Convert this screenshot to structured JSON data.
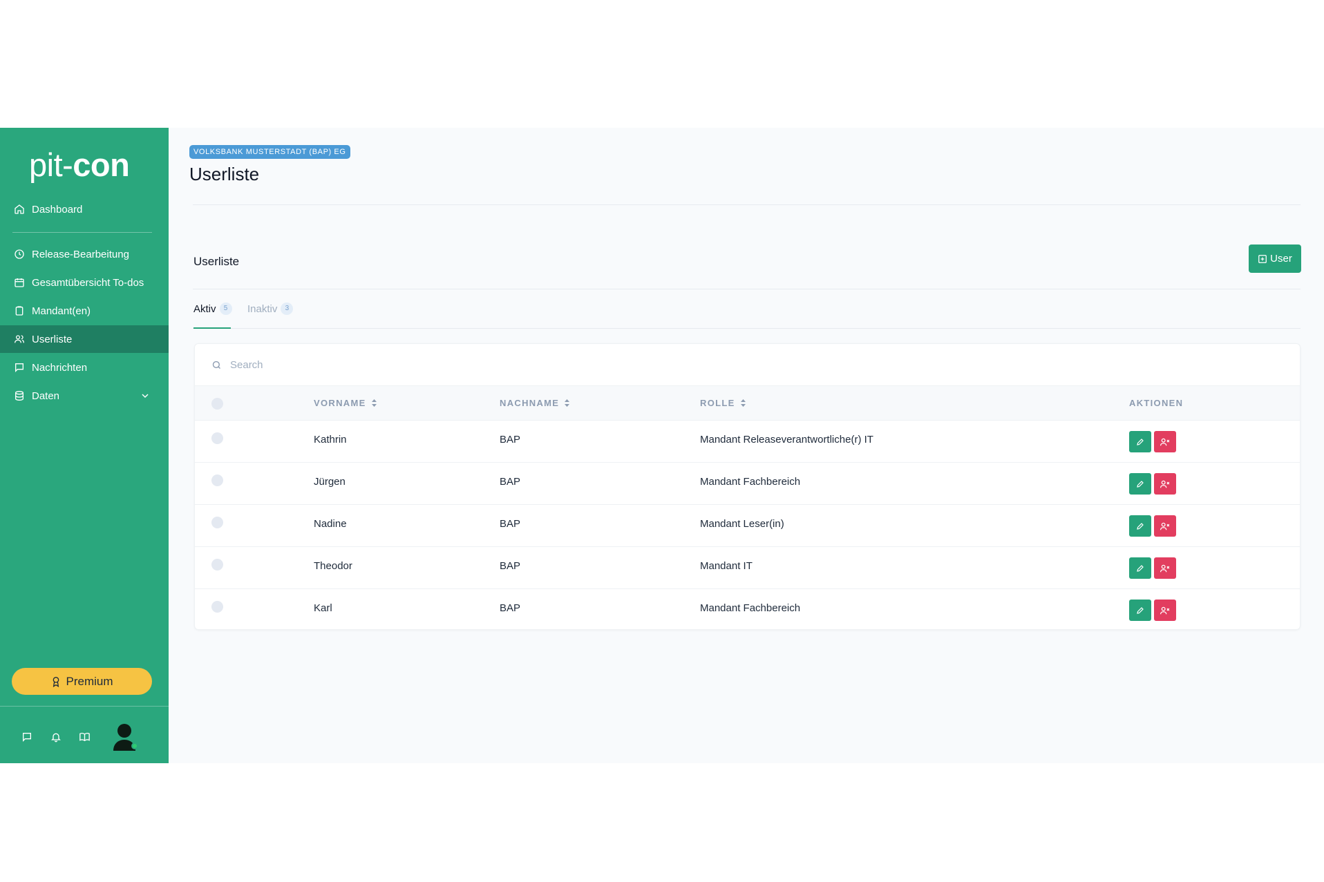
{
  "brand": {
    "logo_light": "pit-",
    "logo_bold": "con"
  },
  "sidebar": {
    "items": [
      {
        "label": "Dashboard"
      },
      {
        "label": "Release-Bearbeitung"
      },
      {
        "label": "Gesamtübersicht To-dos"
      },
      {
        "label": "Mandant(en)"
      },
      {
        "label": "Userliste",
        "active": true
      },
      {
        "label": "Nachrichten"
      },
      {
        "label": "Daten"
      }
    ],
    "premium_label": "Premium"
  },
  "header": {
    "badge": "VOLKSBANK MUSTERSTADT (BAP) EG",
    "title": "Userliste"
  },
  "section": {
    "title": "Userliste",
    "add_button": "User"
  },
  "tabs": [
    {
      "label": "Aktiv",
      "count": "5",
      "active": true
    },
    {
      "label": "Inaktiv",
      "count": "3",
      "active": false
    }
  ],
  "search": {
    "placeholder": "Search"
  },
  "table": {
    "columns": [
      "VORNAME",
      "NACHNAME",
      "ROLLE",
      "AKTIONEN"
    ],
    "rows": [
      {
        "vorname": "Kathrin",
        "nachname": "BAP",
        "rolle": "Mandant Releaseverantwortliche(r) IT"
      },
      {
        "vorname": "Jürgen",
        "nachname": "BAP",
        "rolle": "Mandant Fachbereich"
      },
      {
        "vorname": "Nadine",
        "nachname": "BAP",
        "rolle": "Mandant Leser(in)"
      },
      {
        "vorname": "Theodor",
        "nachname": "BAP",
        "rolle": "Mandant IT"
      },
      {
        "vorname": "Karl",
        "nachname": "BAP",
        "rolle": "Mandant Fachbereich"
      }
    ]
  },
  "colors": {
    "sidebar": "#2aa77d",
    "sidebar_active": "#1f7f62",
    "primary": "#26a27a",
    "danger": "#e23d5f",
    "premium": "#f6c343",
    "badge": "#4b9ad6"
  }
}
